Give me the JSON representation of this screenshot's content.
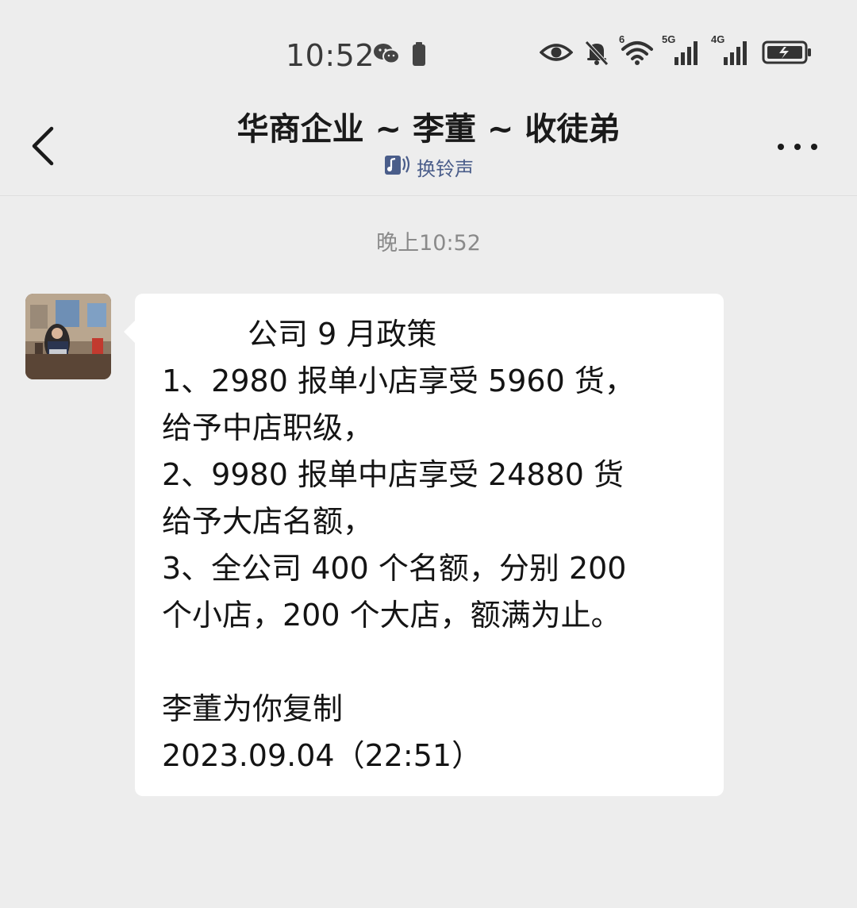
{
  "status_bar": {
    "time": "10:52",
    "left_icons": [
      "wechat-icon",
      "battery-saver-icon"
    ],
    "right_icons": [
      "eye-icon",
      "mute-bell-icon",
      "wifi-icon",
      "signal-5g-icon",
      "signal-4g-icon",
      "battery-icon"
    ],
    "wifi_tag": "6",
    "net_5g": "5G",
    "net_4g": "4G"
  },
  "header": {
    "title": "华商企业 ~ 李董 ~ 收徒弟",
    "subtitle": "换铃声",
    "subtitle_icon": "music-note-icon",
    "more_icon": "more-icon",
    "back_icon": "back-chevron-icon"
  },
  "chat": {
    "timestamp": "晚上10:52",
    "message": {
      "title": "公司 9 月政策",
      "lines": [
        "1、2980 报单小店享受 5960 货，",
        "给予中店职级，",
        "2、9980 报单中店享受 24880 货",
        "给予大店名额，",
        "3、全公司 400 个名额，分别 200",
        "个小店，200 个大店，额满为止。"
      ],
      "footer_lines": [
        "李董为你复制",
        "2023.09.04（22:51）"
      ]
    }
  },
  "colors": {
    "background": "#ededed",
    "bubble": "#ffffff",
    "subtitle_link": "#4a5d8a",
    "timestamp": "#8a8a8a"
  }
}
